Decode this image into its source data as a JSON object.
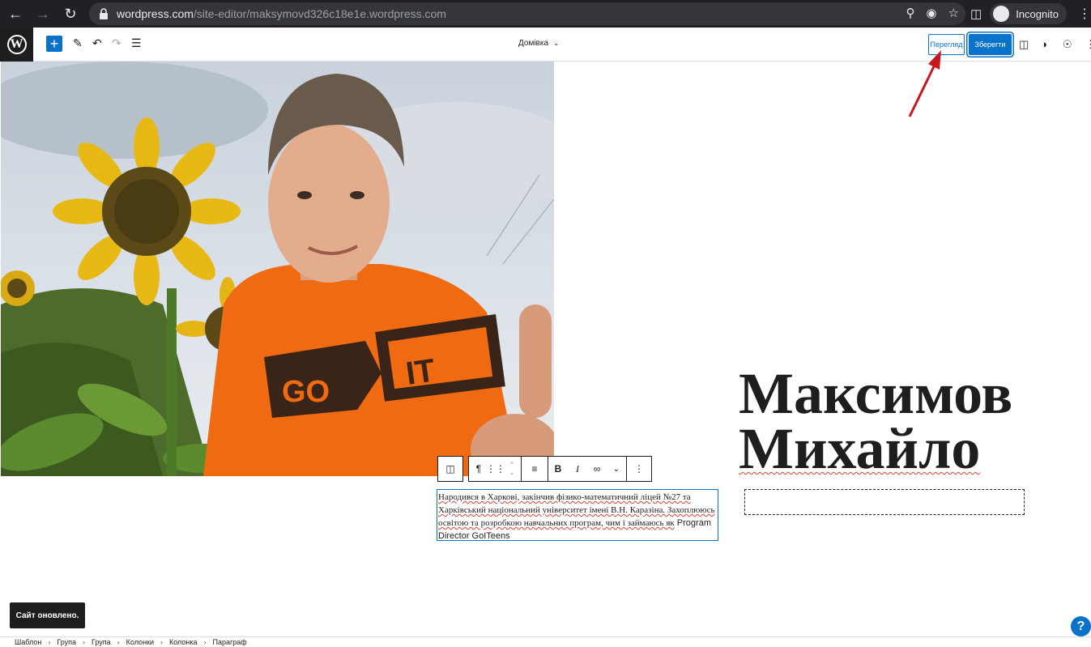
{
  "browser": {
    "url_host": "wordpress.com",
    "url_path": "/site-editor/maksymovd326c18e1e.wordpress.com",
    "profile_label": "Incognito"
  },
  "toolbar": {
    "document_title": "Домівка",
    "preview_label": "Перегляд",
    "save_label": "Зберегти"
  },
  "content": {
    "heading_line1": "Максимов",
    "heading_line2": "Михайло",
    "paragraph_serif": "Народився в Харкові, закінчив фізико-математичний ліцей №27 та Харківський національний університет імені В.Н. Каразіна. Захоплююсь освітою та розробкою навчальних програм, чим і займаюсь як",
    "paragraph_sans": "Program Director GoITeens"
  },
  "photo": {
    "shirt_text_left": "GO",
    "shirt_text_right": "IT"
  },
  "notice": {
    "snackbar_text": "Сайт оновлено."
  },
  "help": {
    "label": "?"
  },
  "breadcrumb": [
    "Шаблон",
    "Група",
    "Група",
    "Колонки",
    "Колонка",
    "Параграф"
  ],
  "colors": {
    "accent": "#0a73c9",
    "annotation": "#c8171f"
  }
}
